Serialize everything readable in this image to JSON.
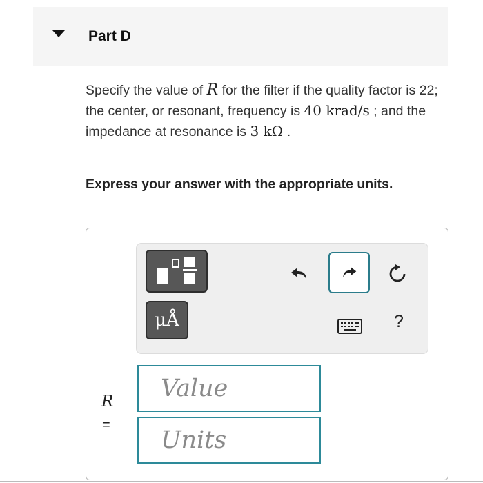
{
  "part": {
    "title": "Part D"
  },
  "question": {
    "text_1": "Specify the value of ",
    "var_r": "R",
    "text_2": " for the filter if the quality factor is 22; the center, or resonant, frequency is ",
    "freq": "40 krad/s",
    "text_3": " ; and the impedance at resonance is ",
    "impedance": "3 kΩ",
    "text_4": " ."
  },
  "instruction": "Express your answer with the appropriate units.",
  "toolbar": {
    "units_label": "μÅ",
    "help_label": "?",
    "icons": [
      "templates-icon",
      "units-icon",
      "undo-icon",
      "redo-icon",
      "reset-icon",
      "keyboard-icon",
      "help-icon"
    ]
  },
  "answer": {
    "variable": "R",
    "equals": "=",
    "value_placeholder": "Value",
    "units_placeholder": "Units"
  },
  "colors": {
    "accent": "#2d8a99",
    "dark_button": "#575757",
    "header_bg": "#f5f5f5"
  }
}
